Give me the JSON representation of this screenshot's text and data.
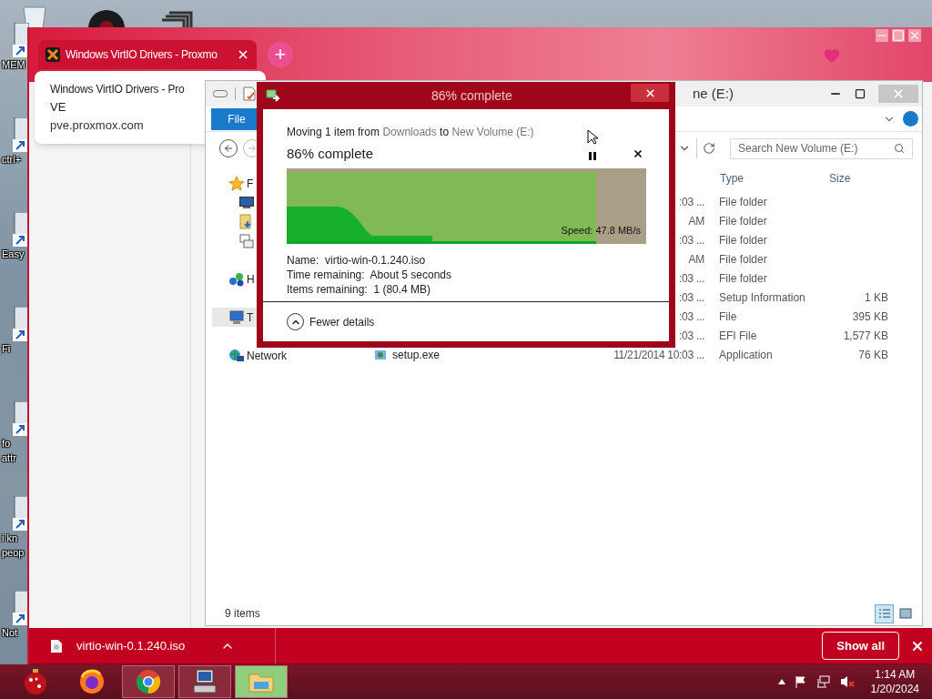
{
  "desktop": {
    "icons": [
      {
        "lines": [
          "MEM"
        ]
      },
      {
        "lines": [
          "ctrl+"
        ]
      },
      {
        "lines": [
          "Easy"
        ]
      },
      {
        "lines": [
          "Fi"
        ]
      },
      {
        "lines": [
          "fo",
          "attr"
        ]
      },
      {
        "lines": [
          "i kn",
          "peop"
        ]
      },
      {
        "lines": [
          "Not"
        ]
      }
    ]
  },
  "browser": {
    "tabs": [
      {
        "title": "Windows VirtIO Drivers - Proxmo",
        "selected": true
      }
    ],
    "new_tab": "+",
    "hover_card": {
      "title": "Windows VirtIO Drivers - Pro",
      "title_rest": "VE",
      "url": "pve.proxmox.com"
    },
    "download_bar": {
      "file": "virtio-win-0.1.240.iso",
      "show_all": "Show all"
    }
  },
  "explorer": {
    "title": "ne (E:)",
    "ribbon_tab": "File",
    "search": {
      "placeholder": "Search New Volume (E:)"
    },
    "nav": [
      {
        "label": "F",
        "kind": "favorites",
        "selected": false
      },
      {
        "kind": "desktop",
        "selected": false
      },
      {
        "kind": "downloads",
        "selected": false
      },
      {
        "kind": "recent",
        "selected": false
      },
      {
        "label": "H",
        "kind": "homegroup",
        "selected": false
      },
      {
        "label": "T",
        "kind": "pc",
        "selected": true
      },
      {
        "label": "Network",
        "kind": "network",
        "selected": false
      }
    ],
    "columns": [
      "Type",
      "Size"
    ],
    "rows": [
      {
        "date": ":03 ...",
        "type": "File folder"
      },
      {
        "date": "AM",
        "type": "File folder"
      },
      {
        "date": ":03 ...",
        "type": "File folder"
      },
      {
        "date": "AM",
        "type": "File folder"
      },
      {
        "date": ":03 ...",
        "type": "File folder"
      },
      {
        "date": ":03 ...",
        "type": "Setup Information",
        "size": "1 KB"
      },
      {
        "date": ":03 ...",
        "type": "File",
        "size": "395 KB"
      },
      {
        "date": ":03 ...",
        "type": "EFI File",
        "size": "1,577 KB"
      },
      {
        "name": "setup.exe",
        "date": "11/21/2014 10:03 ...",
        "type": "Application",
        "size": "76 KB"
      }
    ],
    "status": "9 items",
    "views": [
      {
        "kind": "details",
        "selected": true
      },
      {
        "kind": "large",
        "selected": false
      }
    ]
  },
  "dialog": {
    "title": "86% complete",
    "intro": "Moving 1 item from",
    "source": "Downloads",
    "between": "to",
    "dest": "New Volume (E:)",
    "heading": "86% complete",
    "level": 0.86,
    "speed": "Speed: 47.8 MB/s",
    "details": [
      {
        "label": "Name:",
        "value": "virtio-win-0.1.240.iso"
      },
      {
        "label": "Time remaining:",
        "value": "About 5 seconds"
      },
      {
        "label": "Items remaining:",
        "value": "1 (80.4 MB)"
      }
    ],
    "toggle": "Fewer details"
  },
  "taskbar": {
    "apps": [
      {
        "kind": "ornament",
        "running": false,
        "selected": false
      },
      {
        "kind": "firefox",
        "running": false,
        "selected": false
      },
      {
        "kind": "chrome",
        "running": true,
        "selected": false
      },
      {
        "kind": "computer",
        "running": true,
        "selected": false
      },
      {
        "kind": "folder",
        "running": true,
        "selected": true
      }
    ],
    "time": "1:14 AM",
    "date": "1/20/2024"
  }
}
